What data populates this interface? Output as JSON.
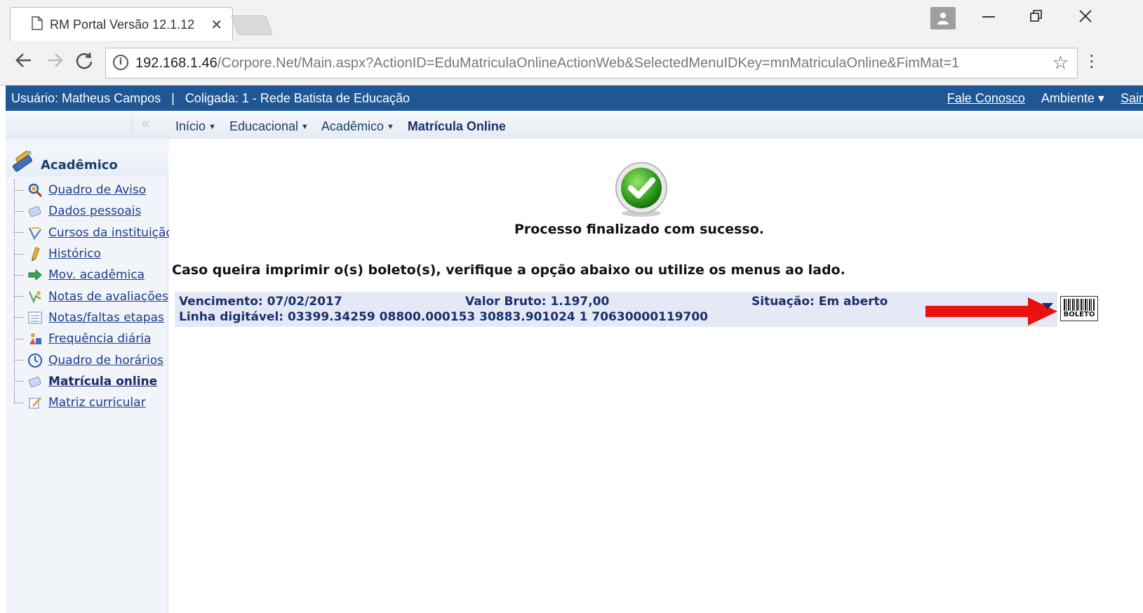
{
  "browser": {
    "tab_title": "RM Portal Versão 12.1.12",
    "tab_close": "✕",
    "url_host": "192.168.1.46",
    "url_path": "/Corpore.Net/Main.aspx?ActionID=EduMatriculaOnlineActionWeb&SelectedMenuIDKey=mnMatriculaOnline&FimMat=1",
    "icons": [
      "page-icon",
      "back-icon",
      "forward-icon",
      "reload-icon",
      "info-icon",
      "star-icon",
      "menu-icon",
      "profile-icon",
      "minimize-icon",
      "restore-icon",
      "close-icon"
    ]
  },
  "portal_header": {
    "user": "Usuário: Matheus Campos",
    "separator": "|",
    "coligada": "Coligada: 1 - Rede Batista de Educação",
    "fale_conosco": "Fale Conosco",
    "ambiente": "Ambiente ▾",
    "sair": "Sair",
    "bg_color": "#1f5694"
  },
  "breadcrumb": {
    "collapse": "‹‹",
    "items": [
      {
        "label": "Início"
      },
      {
        "label": "Educacional"
      },
      {
        "label": "Acadêmico"
      }
    ],
    "current": "Matrícula Online",
    "caret": "▼"
  },
  "sidebar": {
    "title": "Acadêmico",
    "items": [
      {
        "label": "Quadro de Aviso",
        "icon": "notice-board-icon"
      },
      {
        "label": "Dados pessoais",
        "icon": "personal-data-icon"
      },
      {
        "label": "Cursos da instituição",
        "icon": "courses-icon"
      },
      {
        "label": "Histórico",
        "icon": "history-icon"
      },
      {
        "label": "Mov. acadêmica",
        "icon": "academic-movement-icon"
      },
      {
        "label": "Notas de avaliações",
        "icon": "grades-icon"
      },
      {
        "label": "Notas/faltas etapas",
        "icon": "grades-absences-icon"
      },
      {
        "label": "Frequência diária",
        "icon": "attendance-icon"
      },
      {
        "label": "Quadro de horários",
        "icon": "schedule-icon"
      },
      {
        "label": "Matrícula online",
        "icon": "enrollment-icon",
        "active": true
      },
      {
        "label": "Matriz curricular",
        "icon": "curriculum-icon"
      }
    ]
  },
  "main": {
    "success_message": "Processo finalizado com sucesso.",
    "instruction": "Caso queira imprimir o(s) boleto(s), verifique a opção abaixo ou utilize os menus ao lado.",
    "boleto": {
      "vencimento": "Vencimento: 07/02/2017",
      "valor_bruto": "Valor Bruto: 1.197,00",
      "situacao": "Situação: Em aberto",
      "linha_digitavel": "Linha digitável: 03399.34259 08800.000153 30883.901024 1 70630000119700",
      "button_label": "BOLETO"
    },
    "accent_arrow_color": "#e8120c"
  }
}
